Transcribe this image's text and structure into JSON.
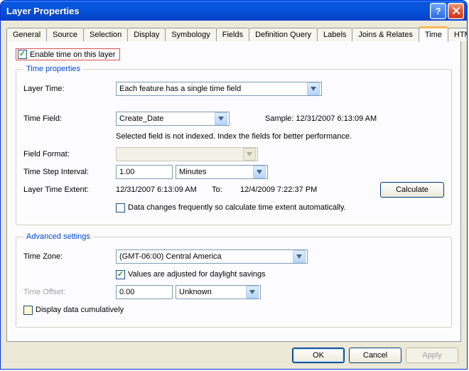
{
  "title": "Layer Properties",
  "tabs": [
    "General",
    "Source",
    "Selection",
    "Display",
    "Symbology",
    "Fields",
    "Definition Query",
    "Labels",
    "Joins & Relates",
    "Time",
    "HTML Popup"
  ],
  "active_tab": "Time",
  "enable_checkbox_label": "Enable time on this layer",
  "time_props": {
    "legend": "Time properties",
    "layer_time_label": "Layer Time:",
    "layer_time_value": "Each feature has a single time field",
    "time_field_label": "Time Field:",
    "time_field_value": "Create_Date",
    "sample_label": "Sample:",
    "sample_value": "12/31/2007 6:13:09 AM",
    "not_indexed_msg": "Selected field is not indexed. Index the fields for better performance.",
    "field_format_label": "Field Format:",
    "field_format_value": "",
    "step_label": "Time Step Interval:",
    "step_value": "1.00",
    "step_unit": "Minutes",
    "extent_label": "Layer Time Extent:",
    "extent_from": "12/31/2007 6:13:09 AM",
    "extent_to_label": "To:",
    "extent_to": "12/4/2009 7:22:37 PM",
    "calculate_btn": "Calculate",
    "auto_label": "Data changes frequently so calculate time extent automatically."
  },
  "adv": {
    "legend": "Advanced settings",
    "tz_label": "Time Zone:",
    "tz_value": "(GMT-06:00) Central America",
    "daylight_label": "Values are adjusted for daylight savings",
    "offset_label": "Time Offset:",
    "offset_value": "0.00",
    "offset_unit": "Unknown",
    "cumulative_label": "Display data cumulatively"
  },
  "buttons": {
    "ok": "OK",
    "cancel": "Cancel",
    "apply": "Apply"
  }
}
